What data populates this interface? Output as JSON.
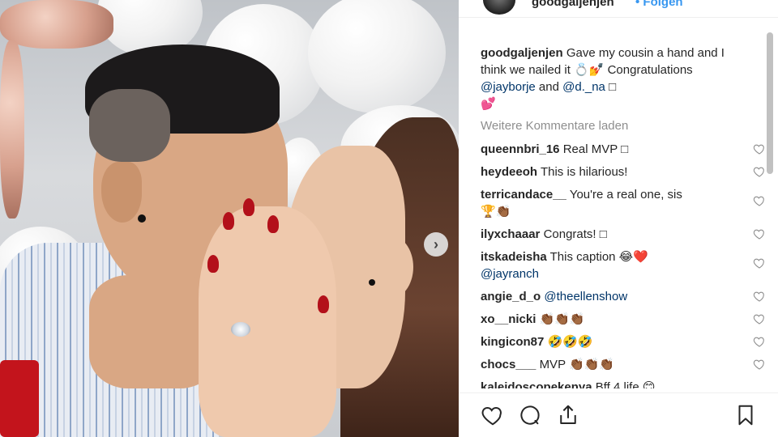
{
  "post": {
    "username": "goodgaljenjen",
    "follow_label": "• Folgen",
    "caption_text": "Gave my cousin a hand and I think we nailed it 💍💅",
    "caption_line2_prefix": "Congratulations ",
    "mention_1": "@jayborje",
    "caption_and": " and ",
    "mention_2": "@d._na",
    "caption_tail": " □",
    "caption_emoji": "💕"
  },
  "load_more_label": "Weitere Kommentare laden",
  "comments": [
    {
      "user": "queennbri_16",
      "text": "Real MVP □"
    },
    {
      "user": "heydeeoh",
      "text": "This is hilarious!"
    },
    {
      "user": "terricandace__",
      "text": "You're a real one, sis",
      "line2": "🏆👏🏾"
    },
    {
      "user": "ilyxchaaar",
      "text": "Congrats! □"
    },
    {
      "user": "itskadeisha",
      "text": "This caption 😂❤️",
      "mention": "@jayranch"
    },
    {
      "user": "angie_d_o",
      "mention": "@theellenshow"
    },
    {
      "user": "xo__nicki",
      "text": "👏🏾👏🏾👏🏾"
    },
    {
      "user": "kingicon87",
      "text": "🤣🤣🤣"
    },
    {
      "user": "chocs___",
      "text": "MVP 👏🏾👏🏾👏🏾"
    },
    {
      "user": "kaleidoscopekenya",
      "text": "Bff 4 life 😊"
    }
  ],
  "icons": {
    "heart": "heart-icon",
    "comment": "comment-icon",
    "share": "share-icon",
    "bookmark": "bookmark-icon",
    "next": "chevron-right-icon"
  },
  "colors": {
    "link": "#003569",
    "follow": "#3897f0",
    "muted": "#8e8e8e",
    "text": "#262626"
  }
}
